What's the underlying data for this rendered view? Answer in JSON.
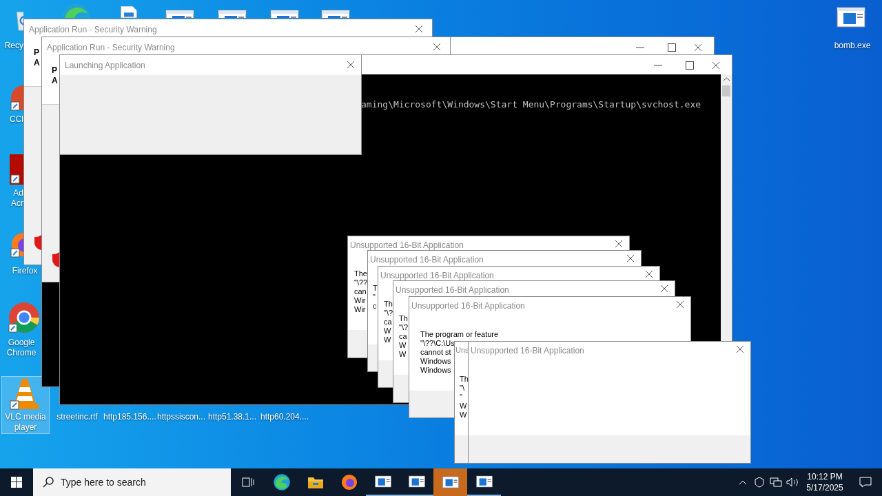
{
  "desktop_icons": [
    {
      "kind": "recycle",
      "label": "Recy",
      "selected": false
    },
    {
      "kind": "edge",
      "selected": false
    },
    {
      "kind": "document",
      "selected": false
    },
    {
      "kind": "window",
      "selected": false
    },
    {
      "kind": "window",
      "selected": false
    },
    {
      "kind": "window",
      "selected": false
    },
    {
      "kind": "window",
      "selected": false
    },
    {
      "kind": "ccleaner",
      "label": "CCl",
      "selected": false
    },
    {
      "kind": "acrobat",
      "label": "Ad Acr",
      "selected": false
    },
    {
      "kind": "firefox",
      "label": "Firefox",
      "selected": false
    },
    {
      "kind": "chrome",
      "label": "Google Chrome",
      "selected": false
    },
    {
      "kind": "vlc",
      "label": "VLC media player",
      "selected": true
    },
    {
      "kind": "file",
      "label": "streetinc.rtf",
      "selected": false
    },
    {
      "kind": "file",
      "label": "http185.156....",
      "selected": false
    },
    {
      "kind": "file",
      "label": "httpssiscon...",
      "selected": false
    },
    {
      "kind": "file",
      "label": "http51.38.1...",
      "selected": false
    },
    {
      "kind": "file",
      "label": "http60.204....",
      "selected": false
    },
    {
      "kind": "window",
      "label": "bomb.exe",
      "selected": false
    }
  ],
  "windows": [
    {
      "kind": "security",
      "title": "Application Run - Security Warning",
      "lines": [
        "P",
        "A"
      ]
    },
    {
      "kind": "console"
    },
    {
      "kind": "security",
      "title": "Application Run - Security Warning",
      "lines": [
        "P",
        "A"
      ]
    },
    {
      "kind": "console",
      "output": "aming\\Microsoft\\Windows\\Start Menu\\Programs\\Startup\\svchost.exe"
    },
    {
      "kind": "launching",
      "title": "Launching Application"
    },
    {
      "kind": "dialog",
      "title": "Unsupported 16-Bit Application",
      "lines": [
        "The",
        "\"\\??",
        "can",
        "Wir",
        "Wir"
      ]
    },
    {
      "kind": "dialog",
      "title": "Unsupported 16-Bit Application",
      "lines": [
        "T",
        "\"",
        "c"
      ]
    },
    {
      "kind": "dialog",
      "title": "Unsupported 16-Bit Application",
      "lines": [
        "Th",
        "\"\\?",
        "ca",
        "W",
        "W"
      ]
    },
    {
      "kind": "dialog",
      "title": "Unsupported 16-Bit Application",
      "lines": [
        "Th",
        "\"\\?",
        "ca",
        "W",
        "W"
      ]
    },
    {
      "kind": "dialog",
      "title": "Unsupported 16-Bit Application",
      "lines": [
        "The program or feature",
        "\"\\??\\C:\\Us",
        "cannot st",
        "Windows",
        "Windows"
      ]
    },
    {
      "kind": "dialog",
      "title": "Uns",
      "lines": [
        "Th",
        "\"\\",
        "\"",
        "W",
        "W"
      ]
    },
    {
      "kind": "dialog",
      "title": "Unsupported 16-Bit Application"
    }
  ],
  "taskbar": {
    "search": {
      "placeholder": "Type here to search"
    },
    "apps": [
      {
        "kind": "taskview",
        "selected": false
      },
      {
        "kind": "edge",
        "selected": false
      },
      {
        "kind": "explorer",
        "selected": false
      },
      {
        "kind": "firefox",
        "selected": false
      },
      {
        "kind": "window",
        "selected": false
      },
      {
        "kind": "window",
        "selected": false
      },
      {
        "kind": "window",
        "selected": true
      },
      {
        "kind": "window",
        "selected": false
      }
    ],
    "time": "10:12 PM",
    "date": "5/17/2025"
  }
}
